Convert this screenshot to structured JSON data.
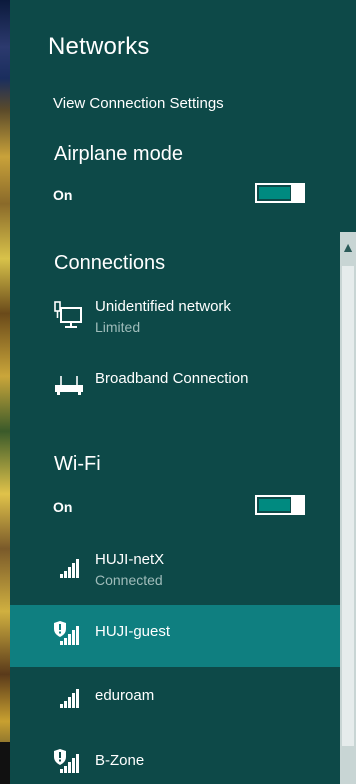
{
  "panel": {
    "title": "Networks",
    "view_settings_link": "View Connection Settings"
  },
  "airplane": {
    "heading": "Airplane mode",
    "state_label": "On",
    "is_on": true
  },
  "connections": {
    "heading": "Connections",
    "items": [
      {
        "name": "Unidentified network",
        "status": "Limited",
        "icon": "wired-network-icon"
      },
      {
        "name": "Broadband Connection",
        "status": "",
        "icon": "broadband-modem-icon"
      }
    ]
  },
  "wifi": {
    "heading": "Wi-Fi",
    "state_label": "On",
    "is_on": true,
    "networks": [
      {
        "name": "HUJI-netX",
        "status": "Connected",
        "secured_warning": false,
        "selected": false,
        "icon": "wifi-signal-icon"
      },
      {
        "name": "HUJI-guest",
        "status": "",
        "secured_warning": true,
        "selected": true,
        "icon": "wifi-signal-open-icon"
      },
      {
        "name": "eduroam",
        "status": "",
        "secured_warning": false,
        "selected": false,
        "icon": "wifi-signal-icon"
      },
      {
        "name": "B-Zone",
        "status": "",
        "secured_warning": true,
        "selected": false,
        "icon": "wifi-signal-open-icon"
      }
    ]
  },
  "colors": {
    "panel_bg": "#0d4948",
    "selected_bg": "#0f7f80",
    "toggle_fill": "#008a80",
    "secondary_text": "#9fbcba"
  }
}
